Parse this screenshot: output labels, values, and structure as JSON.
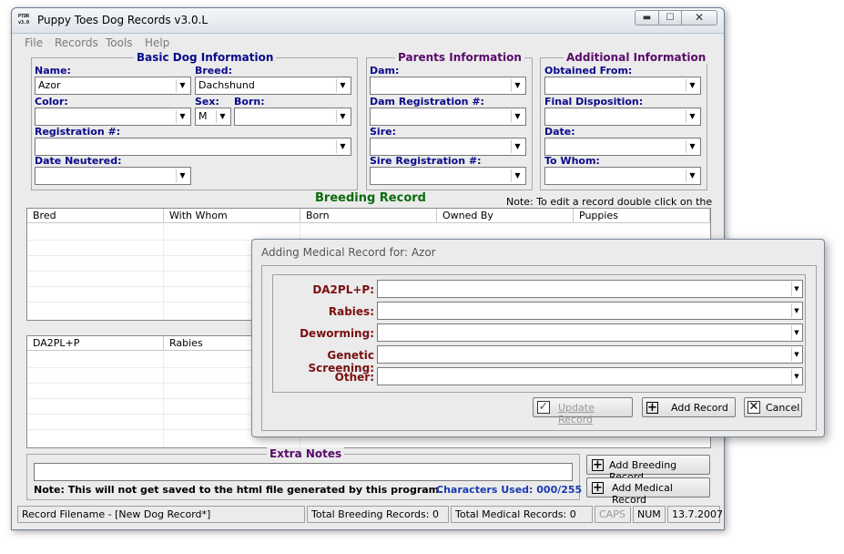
{
  "window": {
    "title": "Puppy Toes Dog Records v3.0.L",
    "icon_text": "PTDR v3.0",
    "controls": {
      "minimize": "▬",
      "maximize": "☐",
      "close": "✕"
    }
  },
  "menu": [
    "File",
    "Records",
    "Tools",
    "Help"
  ],
  "basic": {
    "title": "Basic Dog Information",
    "name_label": "Name:",
    "name_value": "Azor",
    "breed_label": "Breed:",
    "breed_value": "Dachshund",
    "color_label": "Color:",
    "color_value": "",
    "sex_label": "Sex:",
    "sex_value": "M",
    "born_label": "Born:",
    "born_value": "",
    "reg_label": "Registration #:",
    "reg_value": "",
    "neutered_label": "Date Neutered:",
    "neutered_value": ""
  },
  "parents": {
    "title": "Parents Information",
    "dam_label": "Dam:",
    "dam_reg_label": "Dam Registration #:",
    "sire_label": "Sire:",
    "sire_reg_label": "Sire Registration #:"
  },
  "additional": {
    "title": "Additional Information",
    "obtained_label": "Obtained From:",
    "disposition_label": "Final Disposition:",
    "date_label": "Date:",
    "whom_label": "To Whom:"
  },
  "breeding": {
    "title": "Breeding Record",
    "note": "Note: To edit a record double click on the row.",
    "columns": [
      "Bred",
      "With Whom",
      "Born",
      "Owned By",
      "Puppies"
    ]
  },
  "medical": {
    "columns": [
      "DA2PL+P",
      "Rabies"
    ]
  },
  "notes": {
    "title": "Extra Notes",
    "value": "",
    "warning": "Note: This will not get saved to the html file generated by this program.",
    "chars_used": "Characters Used: 000/255"
  },
  "buttons": {
    "add_breeding": "Add Breeding Record",
    "add_medical": "Add Medical Record"
  },
  "status": {
    "filename": "Record Filename - [New Dog Record*]",
    "breeding_total": "Total Breeding Records: 0",
    "medical_total": "Total Medical Records: 0",
    "caps": "CAPS",
    "num": "NUM",
    "date": "13.7.2007"
  },
  "dialog": {
    "title": "Adding Medical Record for: Azor",
    "fields": [
      "DA2PL+P:",
      "Rabies:",
      "Deworming:",
      "Genetic Screening:",
      "Other:"
    ],
    "update_label": "Update Record",
    "add_label": "Add Record",
    "cancel_label": "Cancel"
  }
}
